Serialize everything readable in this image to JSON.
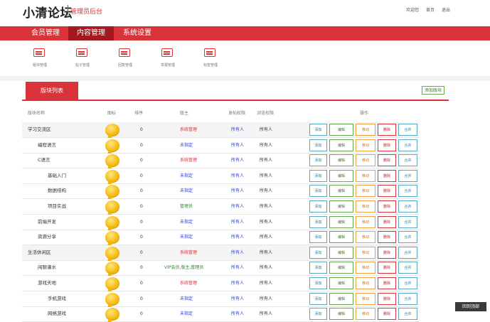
{
  "brand": {
    "title": "小清论坛",
    "subtitle": "管理员后台"
  },
  "topbar": {
    "welcome": "欢迎您",
    "user_links": [
      "首页",
      "退出"
    ]
  },
  "nav": [
    {
      "label": "会员管理",
      "active": false
    },
    {
      "label": "内容管理",
      "active": true
    },
    {
      "label": "系统设置",
      "active": false
    }
  ],
  "quick": [
    {
      "label": "版块管理",
      "icon": "board-icon"
    },
    {
      "label": "帖子管理",
      "icon": "post-icon"
    },
    {
      "label": "回复管理",
      "icon": "reply-icon"
    },
    {
      "label": "举报管理",
      "icon": "report-icon"
    },
    {
      "label": "标签管理",
      "icon": "tag-icon"
    }
  ],
  "panel": {
    "tab_label": "版块列表",
    "add_label": "添加版块"
  },
  "table": {
    "headers": [
      "版块名称",
      "图标",
      "排序",
      "版主",
      "发帖权限",
      "浏览权限",
      "操作"
    ],
    "ops": [
      "添加",
      "编辑",
      "移动",
      "删除",
      "合并"
    ],
    "rows": [
      {
        "name": "学习交流区",
        "sort": "0",
        "mod": "系统管理",
        "modType": "hot",
        "post": "所有人",
        "view": "所有人",
        "alt": true,
        "indent": 0
      },
      {
        "name": "编程语言",
        "sort": "0",
        "mod": "未指定",
        "modType": "blue",
        "post": "所有人",
        "view": "所有人",
        "alt": false,
        "indent": 1
      },
      {
        "name": "C语言",
        "sort": "0",
        "mod": "系统管理",
        "modType": "hot",
        "post": "所有人",
        "view": "所有人",
        "alt": false,
        "indent": 1
      },
      {
        "name": "基础入门",
        "sort": "0",
        "mod": "未指定",
        "modType": "blue",
        "post": "所有人",
        "view": "所有人",
        "alt": false,
        "indent": 2
      },
      {
        "name": "数据结构",
        "sort": "0",
        "mod": "未指定",
        "modType": "blue",
        "post": "所有人",
        "view": "所有人",
        "alt": false,
        "indent": 2
      },
      {
        "name": "项目实战",
        "sort": "0",
        "mod": "管理员",
        "modType": "green",
        "post": "所有人",
        "view": "所有人",
        "alt": false,
        "indent": 2
      },
      {
        "name": "前端开发",
        "sort": "0",
        "mod": "未指定",
        "modType": "blue",
        "post": "所有人",
        "view": "所有人",
        "alt": false,
        "indent": 1
      },
      {
        "name": "资源分享",
        "sort": "0",
        "mod": "未指定",
        "modType": "blue",
        "post": "所有人",
        "view": "所有人",
        "alt": false,
        "indent": 1
      },
      {
        "name": "生活休闲区",
        "sort": "0",
        "mod": "系统管理",
        "modType": "hot",
        "post": "所有人",
        "view": "所有人",
        "alt": true,
        "indent": 0
      },
      {
        "name": "闲聊灌水",
        "sort": "0",
        "mod": "VIP会员,版主,管理员",
        "modType": "green",
        "post": "所有人",
        "view": "所有人",
        "alt": false,
        "indent": 1
      },
      {
        "name": "游戏天地",
        "sort": "0",
        "mod": "系统管理",
        "modType": "hot",
        "post": "所有人",
        "view": "所有人",
        "alt": false,
        "indent": 1
      },
      {
        "name": "手机游戏",
        "sort": "0",
        "mod": "未指定",
        "modType": "blue",
        "post": "所有人",
        "view": "所有人",
        "alt": false,
        "indent": 2
      },
      {
        "name": "网络游戏",
        "sort": "0",
        "mod": "未指定",
        "modType": "blue",
        "post": "所有人",
        "view": "所有人",
        "alt": false,
        "indent": 2
      }
    ]
  },
  "float_widget": {
    "label": "回到顶部"
  }
}
